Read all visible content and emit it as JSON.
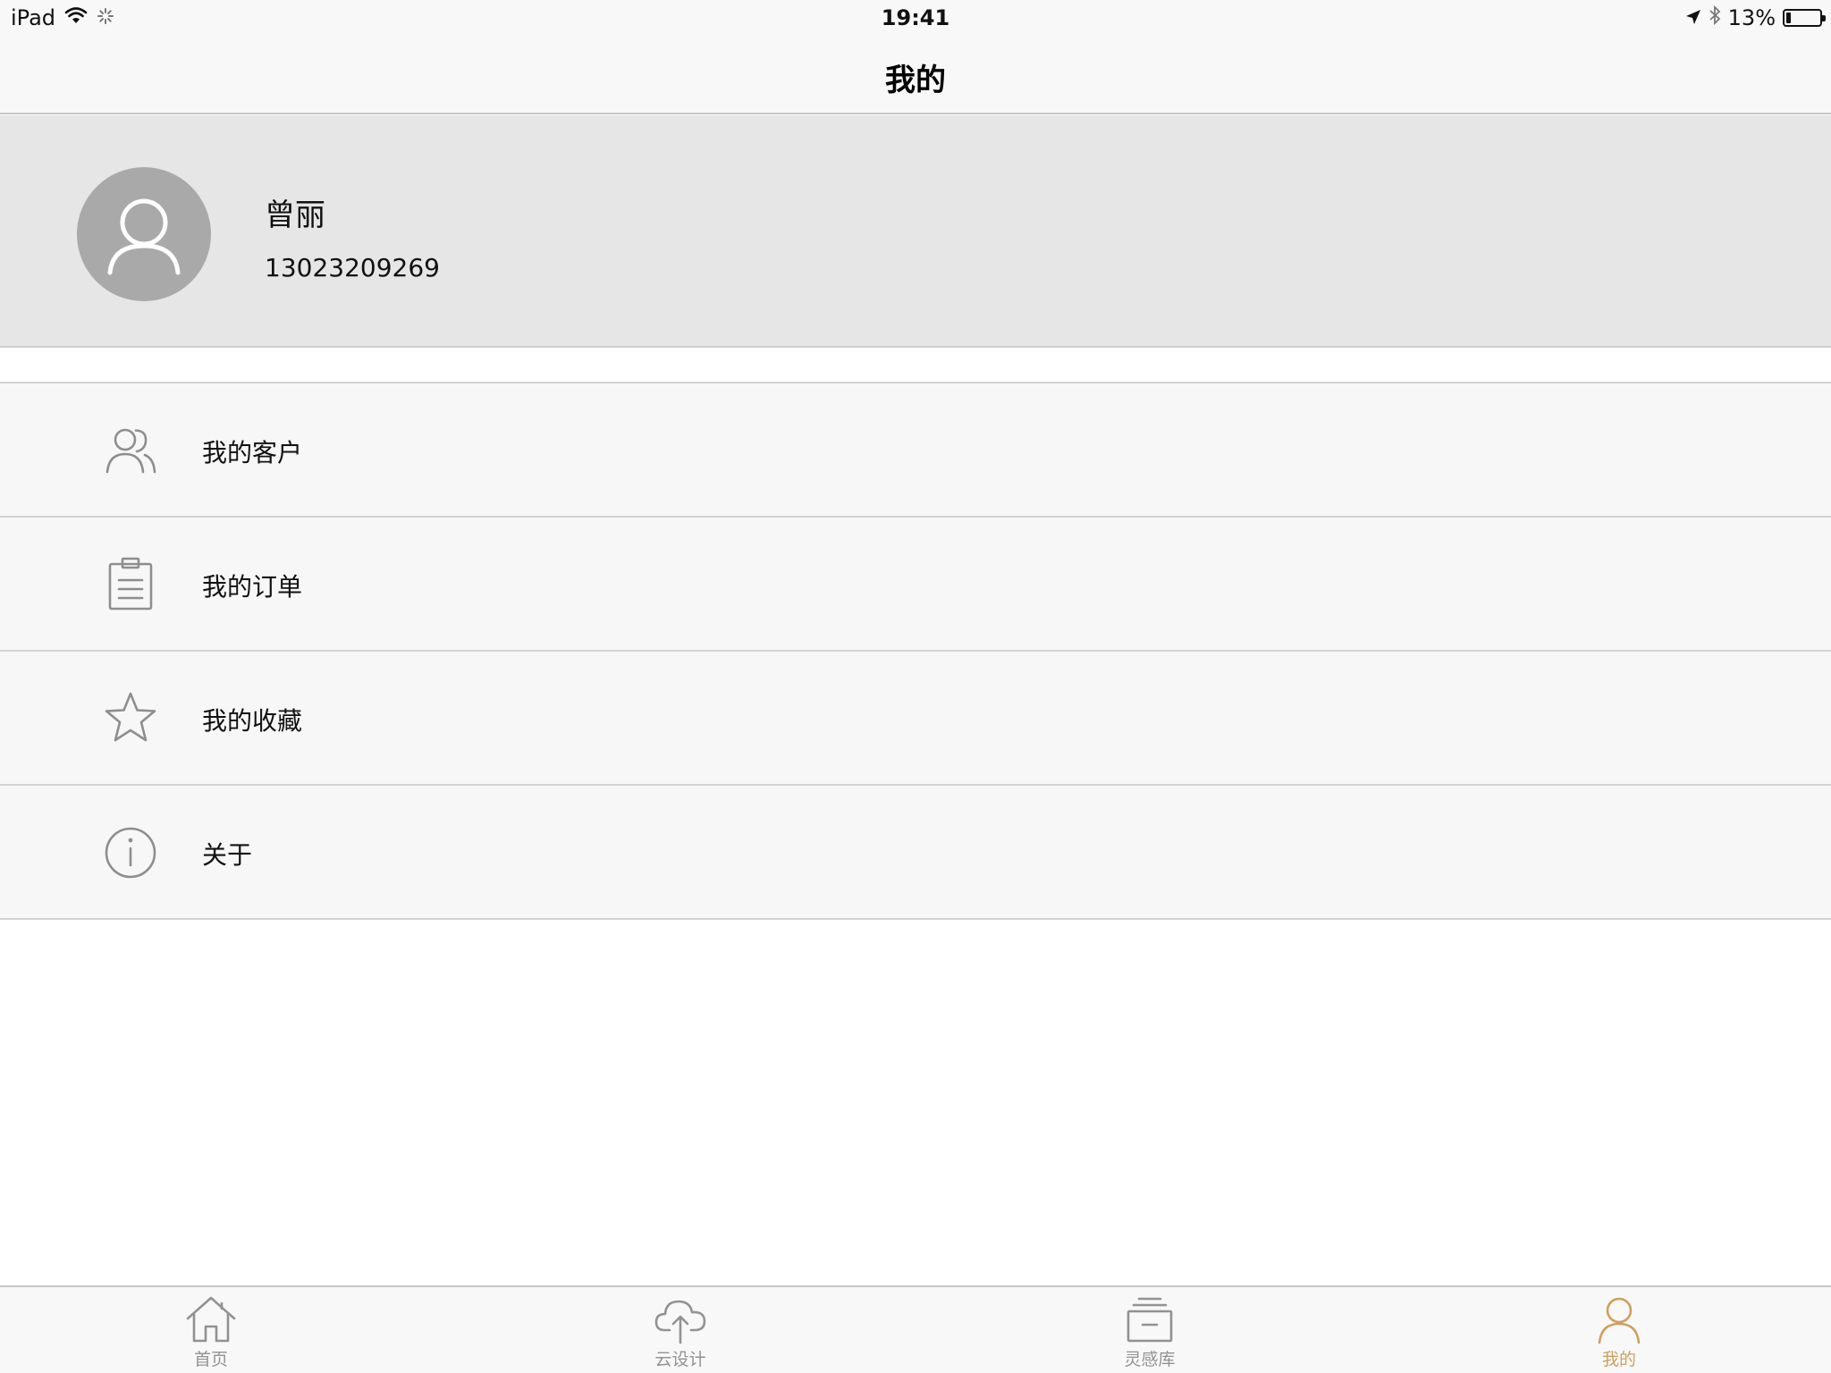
{
  "status_bar": {
    "device": "iPad",
    "time": "19:41",
    "battery": "13%",
    "battery_level": 0.13
  },
  "nav": {
    "title": "我的"
  },
  "profile": {
    "name": "曾丽",
    "phone": "13023209269",
    "icon": "user-avatar-icon"
  },
  "menu": [
    {
      "label": "我的客户",
      "icon": "customers-icon"
    },
    {
      "label": "我的订单",
      "icon": "clipboard-icon"
    },
    {
      "label": "我的收藏",
      "icon": "star-icon"
    },
    {
      "label": "关于",
      "icon": "info-icon"
    }
  ],
  "tabs": [
    {
      "label": "首页",
      "icon": "home-icon",
      "active": false
    },
    {
      "label": "云设计",
      "icon": "cloud-upload-icon",
      "active": false
    },
    {
      "label": "灵感库",
      "icon": "inbox-icon",
      "active": false
    },
    {
      "label": "我的",
      "icon": "person-icon",
      "active": true
    }
  ],
  "colors": {
    "accent": "#cf9f5e",
    "icon_gray": "#8e8e8e",
    "profile_bg": "#e6e6e6",
    "avatar_bg": "#a9a9a9"
  }
}
